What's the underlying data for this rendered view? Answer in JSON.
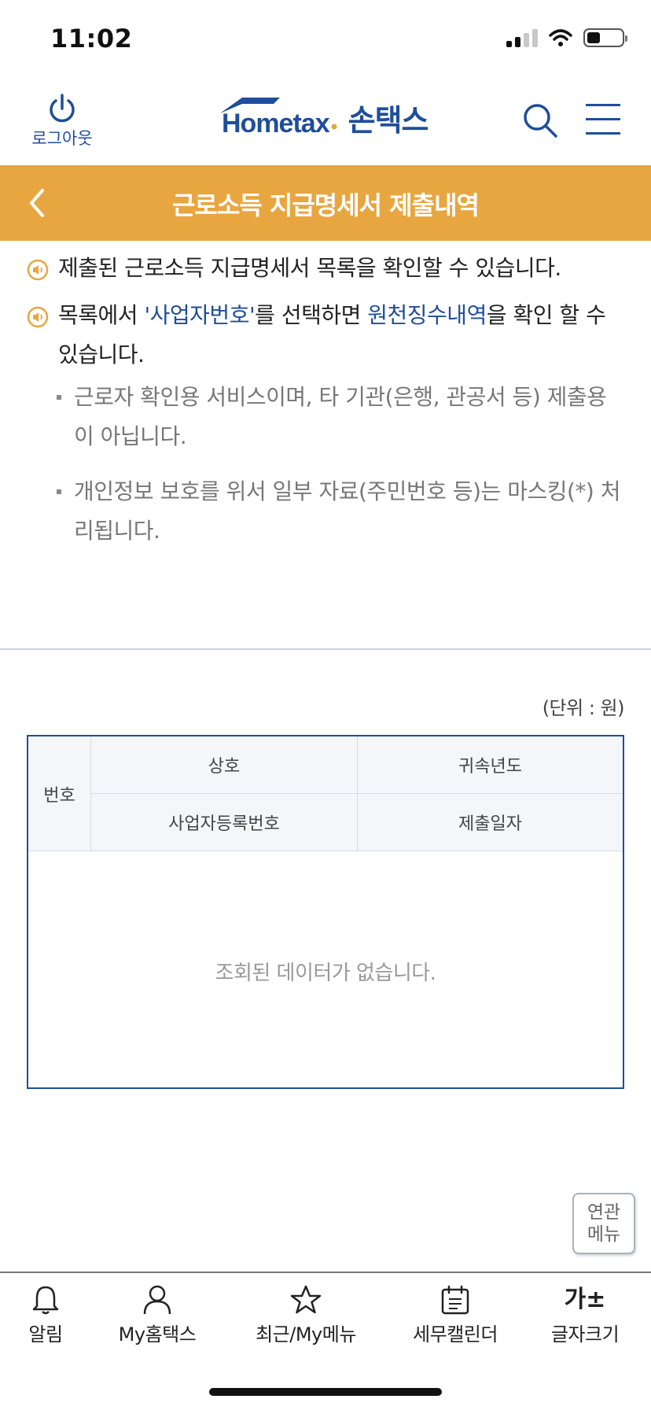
{
  "status_bar": {
    "time": "11:02"
  },
  "header": {
    "logout_label": "로그아웃",
    "logo_en": "Hometax",
    "logo_ko": "손택스"
  },
  "titlebar": {
    "title": "근로소득 지급명세서 제출내역"
  },
  "notices": [
    {
      "before": "제출된 근로소득 지급명세서 목록을 확인할 수 있습니다.",
      "link1": "",
      "middle": "",
      "link2": "",
      "after": ""
    },
    {
      "before": "목록에서 ",
      "link1": "'사업자번호'",
      "middle": "를 선택하면 ",
      "link2": "원천징수내역",
      "after": "을 확인 할 수 있습니다."
    }
  ],
  "bullets": [
    "근로자 확인용 서비스이며, 타 기관(은행, 관공서 등) 제출용이 아닙니다.",
    "개인정보 보호를 위서 일부 자료(주민번호 등)는 마스킹(*) 처리됩니다."
  ],
  "unit_label": "(단위 : 원)",
  "table": {
    "headers": {
      "no": "번호",
      "name": "상호",
      "year": "귀속년도",
      "biz_no": "사업자등록번호",
      "date": "제출일자"
    },
    "empty_message": "조회된 데이터가 없습니다."
  },
  "related_menu": {
    "line1": "연관",
    "line2": "메뉴"
  },
  "bottom_nav": {
    "items": [
      {
        "label": "알림",
        "icon": "bell-icon"
      },
      {
        "label": "My홈택스",
        "icon": "person-icon"
      },
      {
        "label": "최근/My메뉴",
        "icon": "star-icon"
      },
      {
        "label": "세무캘린더",
        "icon": "calendar-icon"
      },
      {
        "label": "글자크기",
        "icon": "font-size-icon",
        "glyph": "가±"
      }
    ]
  },
  "colors": {
    "brand_blue": "#1f4e9a",
    "title_orange": "#e8a640",
    "notice_icon": "#e8a640"
  }
}
